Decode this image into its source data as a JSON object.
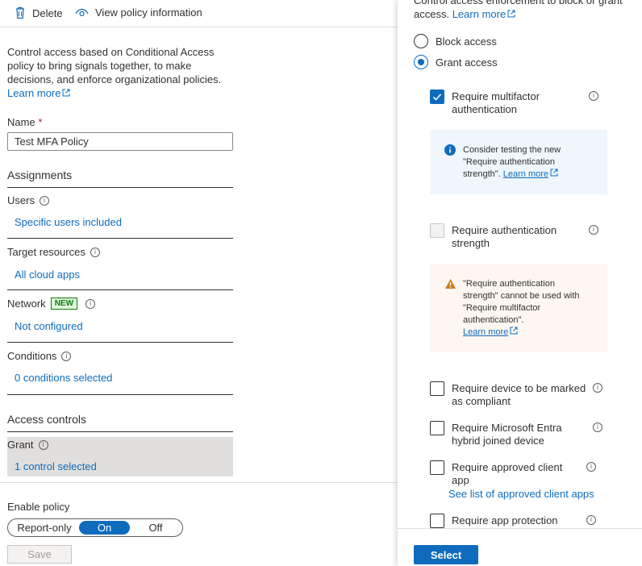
{
  "toolbar": {
    "delete_label": "Delete",
    "view_label": "View policy information"
  },
  "intro": {
    "text": "Control access based on Conditional Access policy to bring signals together, to make decisions, and enforce organizational policies.",
    "learn_more": "Learn more"
  },
  "name": {
    "label": "Name",
    "required_mark": "*",
    "value": "Test MFA Policy"
  },
  "assignments": {
    "heading": "Assignments",
    "users_label": "Users",
    "users_value": "Specific users included",
    "target_label": "Target resources",
    "target_value": "All cloud apps",
    "network_label": "Network",
    "network_badge": "NEW",
    "network_value": "Not configured",
    "conditions_label": "Conditions",
    "conditions_value": "0 conditions selected"
  },
  "access_controls": {
    "heading": "Access controls",
    "grant_label": "Grant",
    "grant_value": "1 control selected"
  },
  "enable_policy": {
    "label": "Enable policy",
    "options": [
      "Report-only",
      "On",
      "Off"
    ],
    "selected": "On",
    "save_label": "Save"
  },
  "panel": {
    "description": "Control access enforcement to block or grant access.",
    "learn_more": "Learn more",
    "block_label": "Block access",
    "grant_label": "Grant access",
    "grant_selected": true,
    "controls": {
      "mfa": "Require multifactor authentication",
      "auth_strength": "Require authentication strength",
      "compliant": "Require device to be marked as compliant",
      "hybrid": "Require Microsoft Entra hybrid joined device",
      "approved_app": "Require approved client app",
      "approved_app_link": "See list of approved client apps",
      "app_protection": "Require app protection"
    },
    "info_message": "Consider testing the new \"Require authentication strength\".",
    "info_link": "Learn more",
    "warning_message": "\"Require authentication strength\" cannot be used with \"Require multifactor authentication\".",
    "warning_link": "Learn more",
    "select_label": "Select",
    "colors": {
      "accent": "#0f6cbd",
      "info_bg": "#eff6fc",
      "warning_bg": "#fdf6f1",
      "warning_icon": "#d47a1b"
    }
  }
}
